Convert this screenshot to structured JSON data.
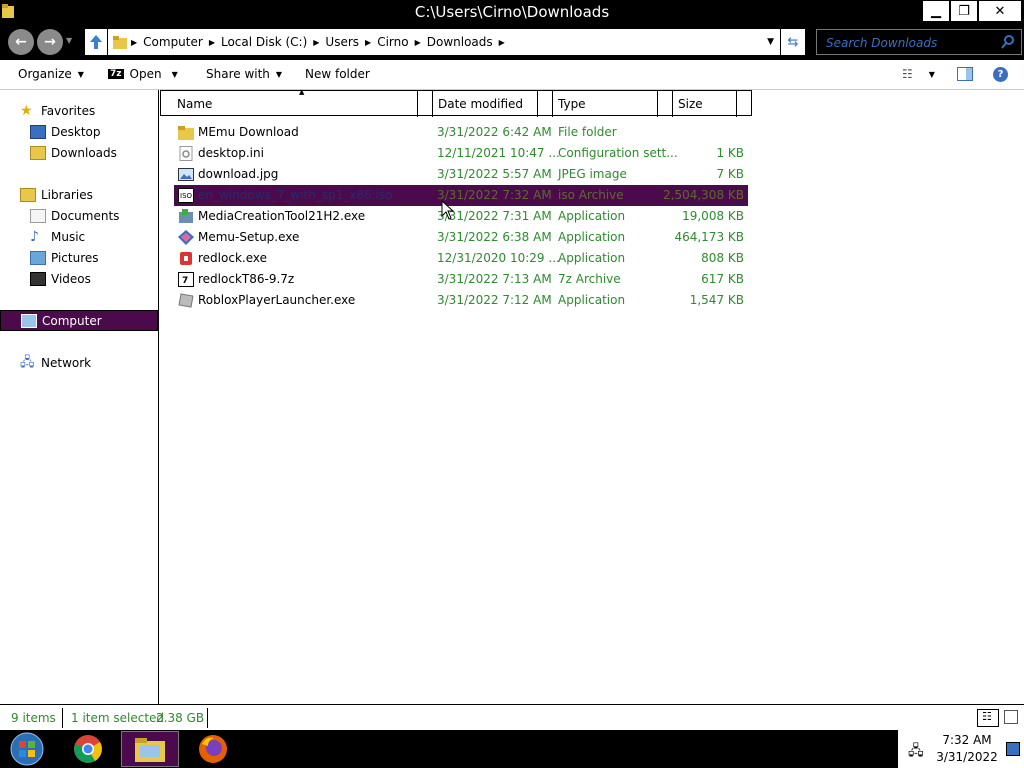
{
  "window": {
    "title": "C:\\Users\\Cirno\\Downloads"
  },
  "address": {
    "crumbs": [
      "Computer",
      "Local Disk (C:)",
      "Users",
      "Cirno",
      "Downloads"
    ],
    "search_placeholder": "Search Downloads"
  },
  "toolbar": {
    "organize": "Organize",
    "open": "Open",
    "share_with": "Share with",
    "new_folder": "New folder"
  },
  "sidebar": {
    "items": [
      {
        "label": "Favorites",
        "icon": "star-icon"
      },
      {
        "label": "Desktop",
        "icon": "desktop-icon"
      },
      {
        "label": "Downloads",
        "icon": "downloads-folder-icon"
      },
      {
        "label": "Libraries",
        "icon": "libraries-icon"
      },
      {
        "label": "Documents",
        "icon": "documents-icon"
      },
      {
        "label": "Music",
        "icon": "music-icon"
      },
      {
        "label": "Pictures",
        "icon": "pictures-icon"
      },
      {
        "label": "Videos",
        "icon": "videos-icon"
      },
      {
        "label": "Computer",
        "icon": "computer-icon"
      },
      {
        "label": "Network",
        "icon": "network-icon"
      }
    ]
  },
  "columns": {
    "name": "Name",
    "date": "Date modified",
    "type": "Type",
    "size": "Size"
  },
  "files": [
    {
      "name": "MEmu Download",
      "date": "3/31/2022 6:42 AM",
      "type": "File folder",
      "size": "",
      "icon": "folder-icon"
    },
    {
      "name": "desktop.ini",
      "date": "12/11/2021 10:47 ...",
      "type": "Configuration sett...",
      "size": "1 KB",
      "icon": "config-file-icon"
    },
    {
      "name": "download.jpg",
      "date": "3/31/2022 5:57 AM",
      "type": "JPEG image",
      "size": "7 KB",
      "icon": "image-file-icon"
    },
    {
      "name": "en_windows_7_with_sp1_x86.iso",
      "date": "3/31/2022 7:32 AM",
      "type": "iso Archive",
      "size": "2,504,308 KB",
      "icon": "iso-file-icon"
    },
    {
      "name": "MediaCreationTool21H2.exe",
      "date": "3/31/2022 7:31 AM",
      "type": "Application",
      "size": "19,008 KB",
      "icon": "media-tool-icon"
    },
    {
      "name": "Memu-Setup.exe",
      "date": "3/31/2022 6:38 AM",
      "type": "Application",
      "size": "464,173 KB",
      "icon": "memu-icon"
    },
    {
      "name": "redlock.exe",
      "date": "12/31/2020 10:29 ...",
      "type": "Application",
      "size": "808 KB",
      "icon": "redlock-icon"
    },
    {
      "name": "redlockT86-9.7z",
      "date": "3/31/2022 7:13 AM",
      "type": "7z Archive",
      "size": "617 KB",
      "icon": "7z-archive-icon"
    },
    {
      "name": "RobloxPlayerLauncher.exe",
      "date": "3/31/2022 7:12 AM",
      "type": "Application",
      "size": "1,547 KB",
      "icon": "roblox-icon"
    }
  ],
  "status": {
    "count": "9 items",
    "selected": "1 item selected",
    "selected_size": "2.38 GB"
  },
  "clock": {
    "time": "7:32 AM",
    "date": "3/31/2022"
  },
  "colors": {
    "selection": "#4b0a4b",
    "green_text": "#2e8b2e",
    "link_blue": "#3a6fc0"
  }
}
